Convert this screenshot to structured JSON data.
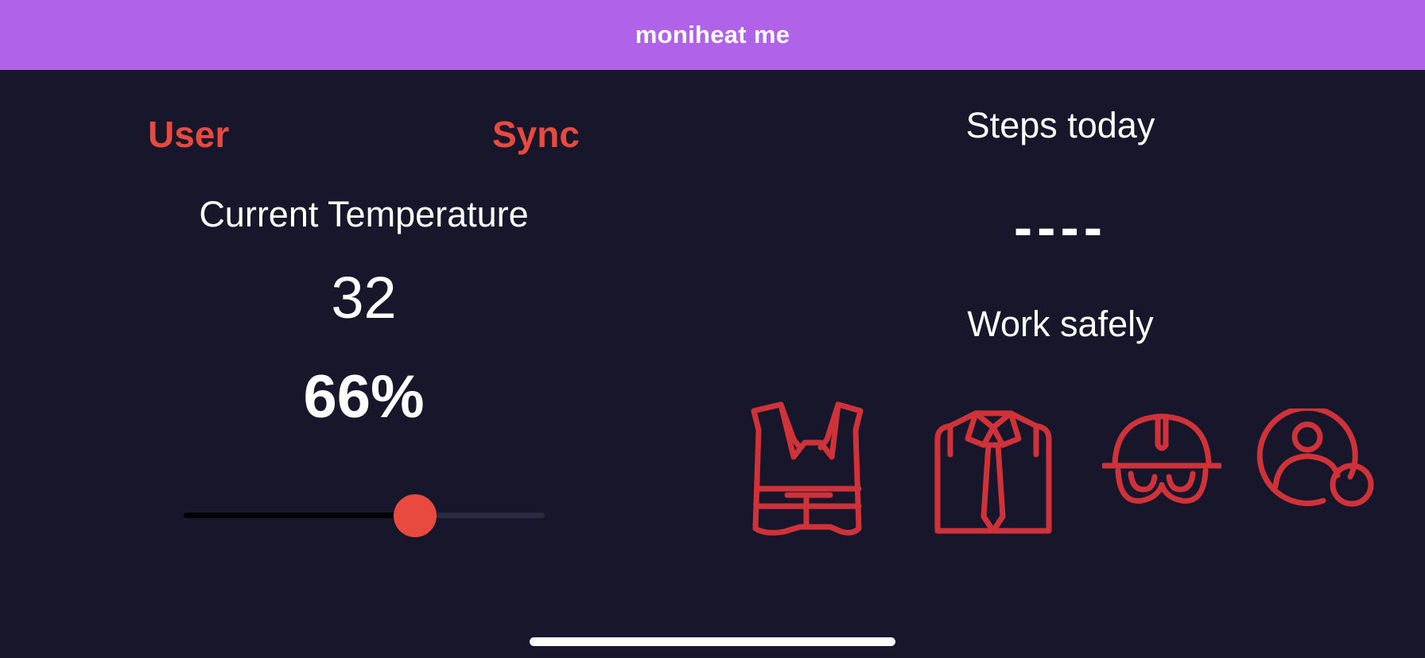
{
  "nav": {
    "title": "moniheat me"
  },
  "buttons": {
    "user_label": "User",
    "sync_label": "Sync"
  },
  "temperature": {
    "label": "Current Temperature",
    "value": "32"
  },
  "humidity": {
    "value": "66%"
  },
  "slider": {
    "level_fraction": 0.64
  },
  "steps": {
    "label": "Steps today",
    "value": "----"
  },
  "safety": {
    "label": "Work safely",
    "icons": [
      "vest-icon",
      "shirt-icon",
      "helmet-icon",
      "user-circle-icon"
    ]
  },
  "colors": {
    "nav_background": "#b062e8",
    "background": "#18162b",
    "accent": "#e84a3f",
    "icon_color": "#d0323a",
    "text": "#ffffff"
  }
}
